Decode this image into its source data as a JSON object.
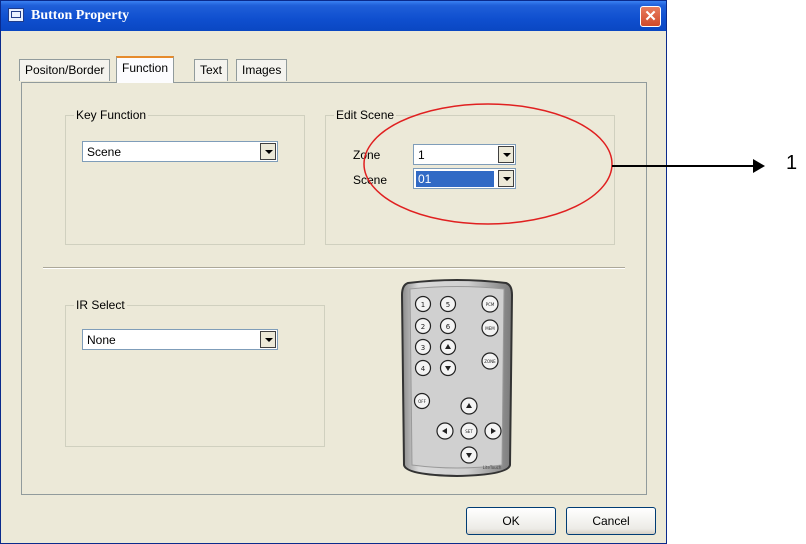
{
  "window": {
    "title": "Button Property",
    "close_icon": "close-icon"
  },
  "tabs": [
    {
      "label": "Positon/Border",
      "active": false
    },
    {
      "label": "Function",
      "active": true
    },
    {
      "label": "Text",
      "active": false
    },
    {
      "label": "Images",
      "active": false
    }
  ],
  "key_function": {
    "legend": "Key Function",
    "value": "Scene"
  },
  "edit_scene": {
    "legend": "Edit Scene",
    "zone_label": "Zone",
    "zone_value": "1",
    "scene_label": "Scene",
    "scene_value": "01"
  },
  "ir_select": {
    "legend": "IR Select",
    "value": "None"
  },
  "remote": {
    "buttons": {
      "b1": "1",
      "b2": "2",
      "b3": "3",
      "b4": "4",
      "b5": "5",
      "b6": "6",
      "pcm": "PCM",
      "mem": "MEM",
      "zone": "ZONE",
      "off": "OFF",
      "set": "SET"
    },
    "brand": "LiteTouch"
  },
  "footer": {
    "ok_label": "OK",
    "cancel_label": "Cancel"
  },
  "annotation": {
    "number": "1"
  },
  "colors": {
    "title_bar": "#0a47c2",
    "highlight_circle": "#e02020",
    "selection": "#316ac5"
  }
}
